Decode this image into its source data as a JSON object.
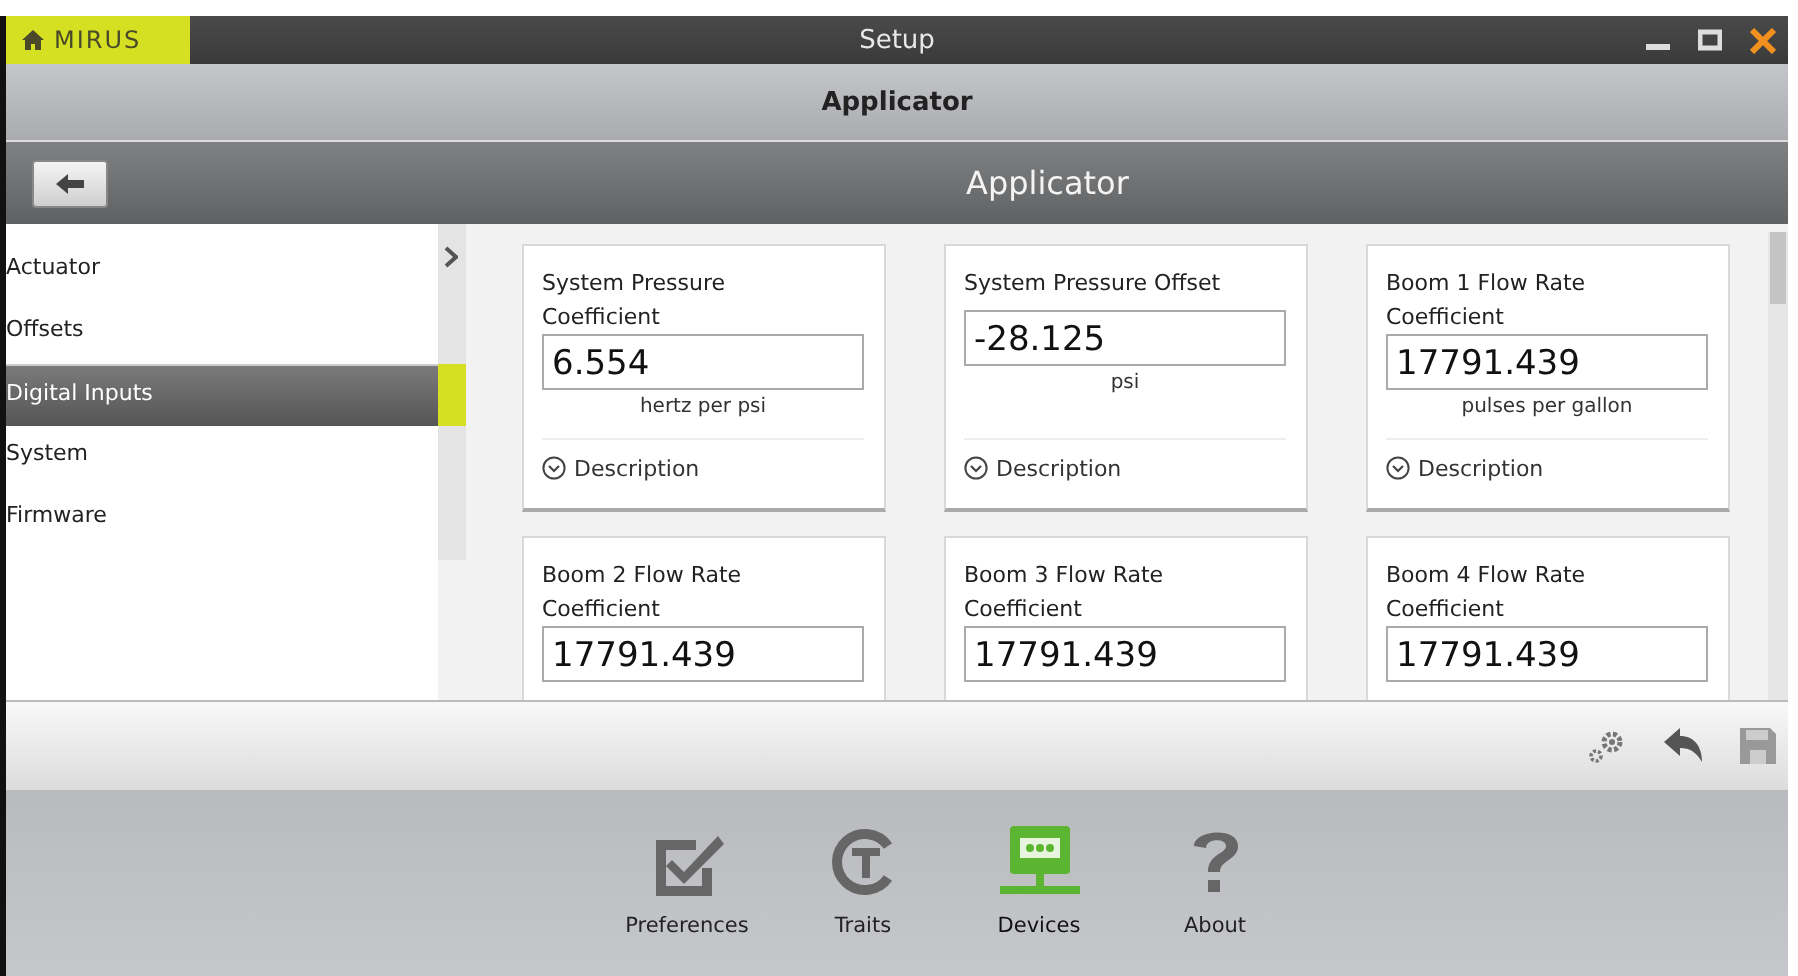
{
  "window": {
    "logo": "MIRUS",
    "title": "Setup"
  },
  "header": {
    "title": "Applicator"
  },
  "toolbar": {
    "title": "Applicator"
  },
  "sidebar": {
    "items": [
      {
        "label": "Actuator",
        "selected": false
      },
      {
        "label": "Offsets",
        "selected": false
      },
      {
        "label": "Digital Inputs",
        "selected": true
      },
      {
        "label": "System",
        "selected": false
      },
      {
        "label": "Firmware",
        "selected": false
      }
    ]
  },
  "cards": [
    {
      "title": "System Pressure Coefficient",
      "value": "6.554",
      "unit": "hertz per psi",
      "description": "Description"
    },
    {
      "title": "System Pressure Offset",
      "value": "-28.125",
      "unit": "psi",
      "description": "Description"
    },
    {
      "title": "Boom 1 Flow Rate Coefficient",
      "value": "17791.439",
      "unit": "pulses per gallon",
      "description": "Description"
    },
    {
      "title": "Boom 2 Flow Rate Coefficient",
      "value": "17791.439"
    },
    {
      "title": "Boom 3 Flow Rate Coefficient",
      "value": "17791.439"
    },
    {
      "title": "Boom 4 Flow Rate Coefficient",
      "value": "17791.439"
    }
  ],
  "nav": [
    {
      "kind": "preferences",
      "label": "Preferences",
      "selected": false
    },
    {
      "kind": "traits",
      "label": "Traits",
      "selected": false
    },
    {
      "kind": "devices",
      "label": "Devices",
      "selected": true
    },
    {
      "kind": "about",
      "label": "About",
      "selected": false
    }
  ]
}
